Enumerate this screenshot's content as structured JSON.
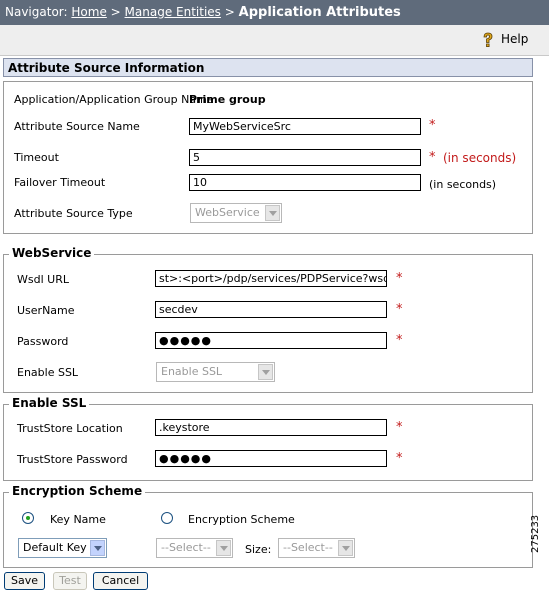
{
  "navigator": {
    "prefix": "Navigator:",
    "home": "Home",
    "sep": ">",
    "manage": "Manage Entities",
    "current": "Application Attributes"
  },
  "help": {
    "label": "Help"
  },
  "attr_source": {
    "header": "Attribute Source Information",
    "app_group_label": "Application/Application Group Name",
    "app_group_value": "Prime group",
    "name_label": "Attribute Source Name",
    "name_value": "MyWebServiceSrc",
    "timeout_label": "Timeout",
    "timeout_value": "5",
    "timeout_unit": "(in seconds)",
    "failover_label": "Failover Timeout",
    "failover_value": "10",
    "failover_unit": "(in seconds)",
    "type_label": "Attribute Source Type",
    "type_value": "WebService",
    "required_mark": "*"
  },
  "webservice": {
    "legend": "WebService",
    "wsdl_label": "Wsdl URL",
    "wsdl_value": "st>:<port>/pdp/services/PDPService?wsdl",
    "user_label": "UserName",
    "user_value": "secdev",
    "password_label": "Password",
    "password_value": "●●●●●",
    "ssl_label": "Enable SSL",
    "ssl_value": "Enable SSL"
  },
  "ssl": {
    "legend": "Enable SSL",
    "truststore_label": "TrustStore Location",
    "truststore_value": ".keystore",
    "truststore_pw_label": "TrustStore Password",
    "truststore_pw_value": "●●●●●"
  },
  "encryption": {
    "legend": "Encryption Scheme",
    "radio_key": "Key Name",
    "radio_scheme": "Encryption Scheme",
    "key_select": "Default Key",
    "scheme_select": "--Select--",
    "size_label": "Size:",
    "size_select": "--Select--"
  },
  "buttons": {
    "save": "Save",
    "test": "Test",
    "cancel": "Cancel"
  },
  "figure_number": "275233"
}
